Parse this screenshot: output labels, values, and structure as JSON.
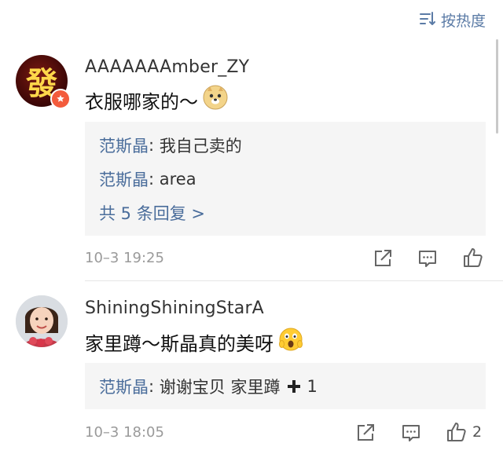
{
  "header": {
    "sort_label": "按热度"
  },
  "comments": [
    {
      "username": "AAAAAAAmber_ZY",
      "text": "衣服哪家的～",
      "avatar_text": "發",
      "replies": [
        {
          "name": "范斯晶",
          "text": "我自己卖的"
        },
        {
          "name": "范斯晶",
          "text": "area"
        }
      ],
      "more_replies": "共 5 条回复 >",
      "time": "10–3 19:25",
      "like_count": ""
    },
    {
      "username": "ShiningShiningStarA",
      "text": "家里蹲～斯晶真的美呀",
      "replies": [
        {
          "name": "范斯晶",
          "text": "谢谢宝贝 家里蹲",
          "suffix": "1"
        }
      ],
      "time": "10–3 18:05",
      "like_count": "2"
    }
  ],
  "colors": {
    "link": "#4a6d9b",
    "reply_bg": "#f5f5f5",
    "meta": "#9a9a9a"
  },
  "icons": [
    "sort-icon",
    "doge-emoji",
    "scream-emoji",
    "plus-icon",
    "share-icon",
    "comment-icon",
    "like-icon"
  ]
}
